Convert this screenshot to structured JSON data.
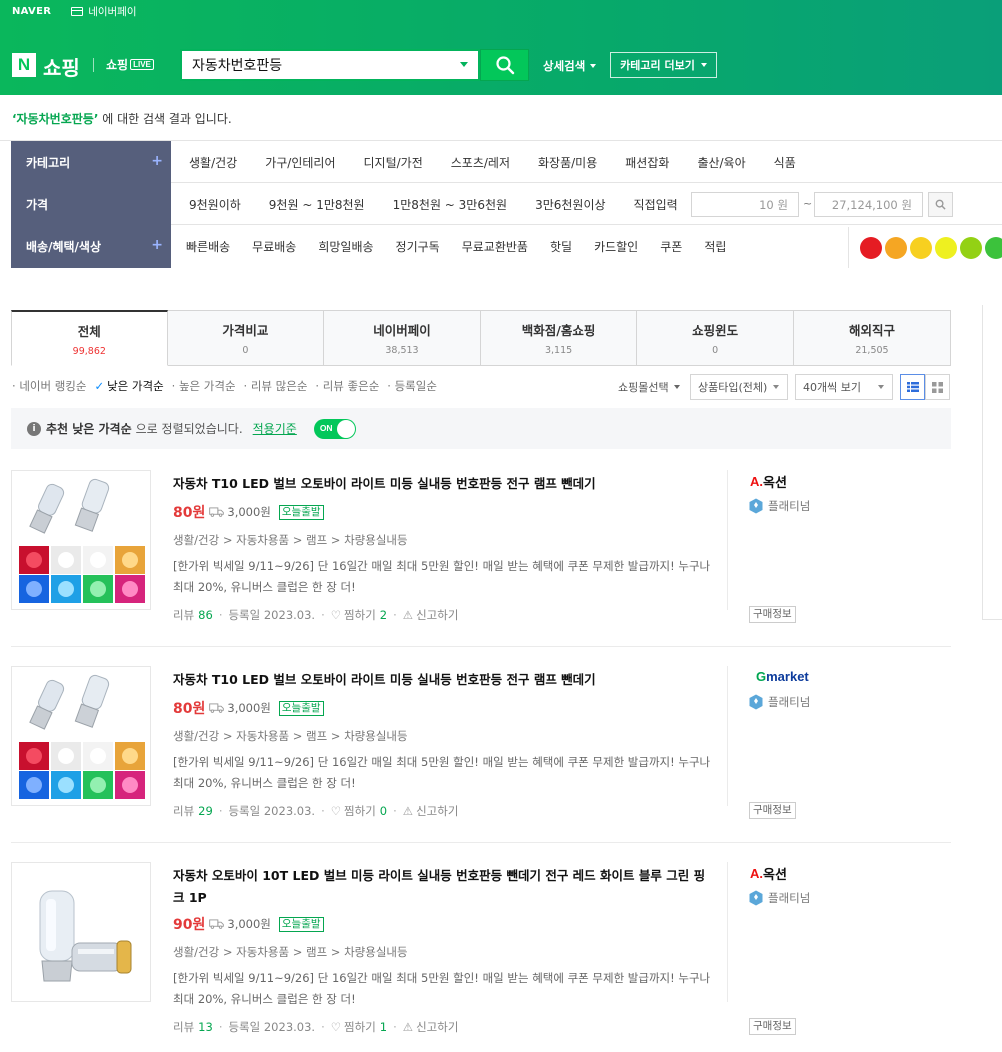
{
  "gnb": {
    "naver": "NAVER",
    "pay": "네이버페이",
    "logo_n": "N",
    "logo_text": "쇼핑",
    "live_prefix": "쇼핑",
    "live_tag": "LIVE",
    "search_value": "자동차번호판등",
    "detail_search": "상세검색",
    "category_more": "카테고리 더보기"
  },
  "result": {
    "keyword": "‘자동차번호판등’",
    "suffix": " 에 대한 검색 결과 입니다."
  },
  "filters": {
    "category": {
      "label": "카테고리",
      "items": [
        "생활/건강",
        "가구/인테리어",
        "디지털/가전",
        "스포츠/레저",
        "화장품/미용",
        "패션잡화",
        "출산/육아",
        "식품"
      ]
    },
    "price": {
      "label": "가격",
      "items": [
        "9천원이하",
        "9천원 ~ 1만8천원",
        "1만8천원 ~ 3만6천원",
        "3만6천원이상",
        "직접입력"
      ],
      "min_value": "10",
      "max_value": "27,124,100",
      "unit": "원",
      "tilde": "~"
    },
    "benefit": {
      "label": "배송/혜택/색상",
      "items": [
        "빠른배송",
        "무료배송",
        "희망일배송",
        "정기구독",
        "무료교환반품",
        "핫딜",
        "카드할인",
        "쿠폰",
        "적립"
      ],
      "colors": [
        "#e51c23",
        "#f5a623",
        "#f7d020",
        "#eef020",
        "#93d114",
        "#3cc23c"
      ]
    }
  },
  "tabs": [
    {
      "label": "전체",
      "count": "99,862"
    },
    {
      "label": "가격비교",
      "count": "0"
    },
    {
      "label": "네이버페이",
      "count": "38,513"
    },
    {
      "label": "백화점/홈쇼핑",
      "count": "3,115"
    },
    {
      "label": "쇼핑윈도",
      "count": "0"
    },
    {
      "label": "해외직구",
      "count": "21,505"
    }
  ],
  "sort": {
    "items": [
      "네이버 랭킹순",
      "낮은 가격순",
      "높은 가격순",
      "리뷰 많은순",
      "리뷰 좋은순",
      "등록일순"
    ],
    "mall_select": "쇼핑몰선택",
    "product_type": "상품타입(전체)",
    "view_count": "40개씩 보기"
  },
  "notice": {
    "info": "i",
    "bold": "추천 낮은 가격순",
    "text": "으로 정렬되었습니다.",
    "link": "적용기준",
    "toggle": "ON"
  },
  "products": [
    {
      "title": "자동차 T10 LED 벌브 오토바이 라이트 미등 실내등 번호판등 전구 램프 뺀데기",
      "price": "80원",
      "shipping": "3,000원",
      "badge": "오늘출발",
      "category": "생활/건강 > 자동차용품 > 램프 > 차량용실내등",
      "desc": "[한가위 빅세일 9/11~9/26] 단 16일간 매일 최대 5만원 할인! 매일 받는 혜택에 쿠폰 무제한 발급까지! 누구나 최대 20%, 유니버스 클럽은 한 장 더!",
      "review_label": "리뷰",
      "review": "86",
      "reg": "등록일 2023.03.",
      "wish_label": "찜하기",
      "wish": "2",
      "report": "신고하기",
      "mall": "옥션",
      "mall_prefix": "A.",
      "grade": "플래티넘",
      "buy_info": "구매정보"
    },
    {
      "title": "자동차 T10 LED 벌브 오토바이 라이트 미등 실내등 번호판등 전구 램프 뺀데기",
      "price": "80원",
      "shipping": "3,000원",
      "badge": "오늘출발",
      "category": "생활/건강 > 자동차용품 > 램프 > 차량용실내등",
      "desc": "[한가위 빅세일 9/11~9/26] 단 16일간 매일 최대 5만원 할인! 매일 받는 혜택에 쿠폰 무제한 발급까지! 누구나 최대 20%, 유니버스 클럽은 한 장 더!",
      "review_label": "리뷰",
      "review": "29",
      "reg": "등록일 2023.03.",
      "wish_label": "찜하기",
      "wish": "0",
      "report": "신고하기",
      "mall_g": "G",
      "mall_rest": "market",
      "grade": "플래티넘",
      "buy_info": "구매정보"
    },
    {
      "title": "자동차 오토바이 10T LED 벌브 미등 라이트 실내등 번호판등 뺀데기 전구 레드 화이트 블루 그린 핑크 1P",
      "price": "90원",
      "shipping": "3,000원",
      "badge": "오늘출발",
      "category": "생활/건강 > 자동차용품 > 램프 > 차량용실내등",
      "desc": "[한가위 빅세일 9/11~9/26] 단 16일간 매일 최대 5만원 할인! 매일 받는 혜택에 쿠폰 무제한 발급까지! 누구나 최대 20%, 유니버스 클럽은 한 장 더!",
      "review_label": "리뷰",
      "review": "13",
      "reg": "등록일 2023.03.",
      "wish_label": "찜하기",
      "wish": "1",
      "report": "신고하기",
      "mall": "옥션",
      "mall_prefix": "A.",
      "grade": "플래티넘",
      "buy_info": "구매정보"
    }
  ]
}
